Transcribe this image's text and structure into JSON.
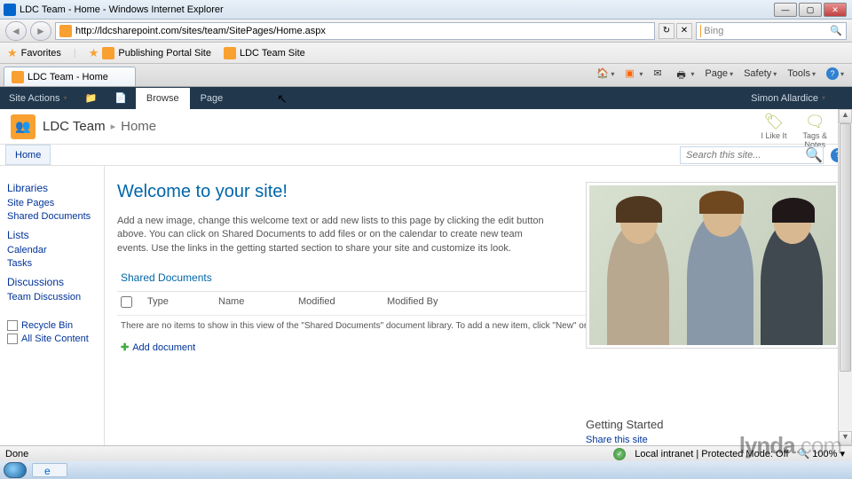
{
  "window": {
    "title": "LDC Team - Home - Windows Internet Explorer"
  },
  "nav": {
    "url": "http://ldcsharepoint.com/sites/team/SitePages/Home.aspx",
    "search_engine": "Bing"
  },
  "favorites": {
    "label": "Favorites",
    "links": [
      "Publishing Portal Site",
      "LDC Team Site"
    ]
  },
  "tab": {
    "title": "LDC Team - Home"
  },
  "commandbar": {
    "page": "Page",
    "safety": "Safety",
    "tools": "Tools"
  },
  "ribbon": {
    "site_actions": "Site Actions",
    "browse": "Browse",
    "page": "Page",
    "user": "Simon Allardice"
  },
  "breadcrumb": {
    "site": "LDC Team",
    "page": "Home"
  },
  "social": {
    "like": "I Like It",
    "tags": "Tags &\nNotes"
  },
  "tabs": {
    "home": "Home"
  },
  "search": {
    "placeholder": "Search this site..."
  },
  "leftnav": {
    "libraries_h": "Libraries",
    "libraries": [
      "Site Pages",
      "Shared Documents"
    ],
    "lists_h": "Lists",
    "lists": [
      "Calendar",
      "Tasks"
    ],
    "discussions_h": "Discussions",
    "discussions": [
      "Team Discussion"
    ],
    "tools": [
      "Recycle Bin",
      "All Site Content"
    ]
  },
  "main": {
    "welcome": "Welcome to your site!",
    "intro": "Add a new image, change this welcome text or add new lists to this page by clicking the edit button above. You can click on Shared Documents to add files or on the calendar to create new team events. Use the links in the getting started section to share your site and customize its look.",
    "section": "Shared Documents",
    "cols": [
      "",
      "Type",
      "Name",
      "Modified",
      "Modified By"
    ],
    "empty": "There are no items to show in this view of the \"Shared Documents\" document library. To add a new item, click \"New\" or \"Upload\".",
    "add": "Add document",
    "getting": "Getting Started",
    "getting_link": "Share this site"
  },
  "status": {
    "left": "Done",
    "zone": "Local intranet | Protected Mode: Off",
    "zoom": "100%"
  },
  "watermark": {
    "brand": "lynda",
    "suffix": ".com"
  }
}
